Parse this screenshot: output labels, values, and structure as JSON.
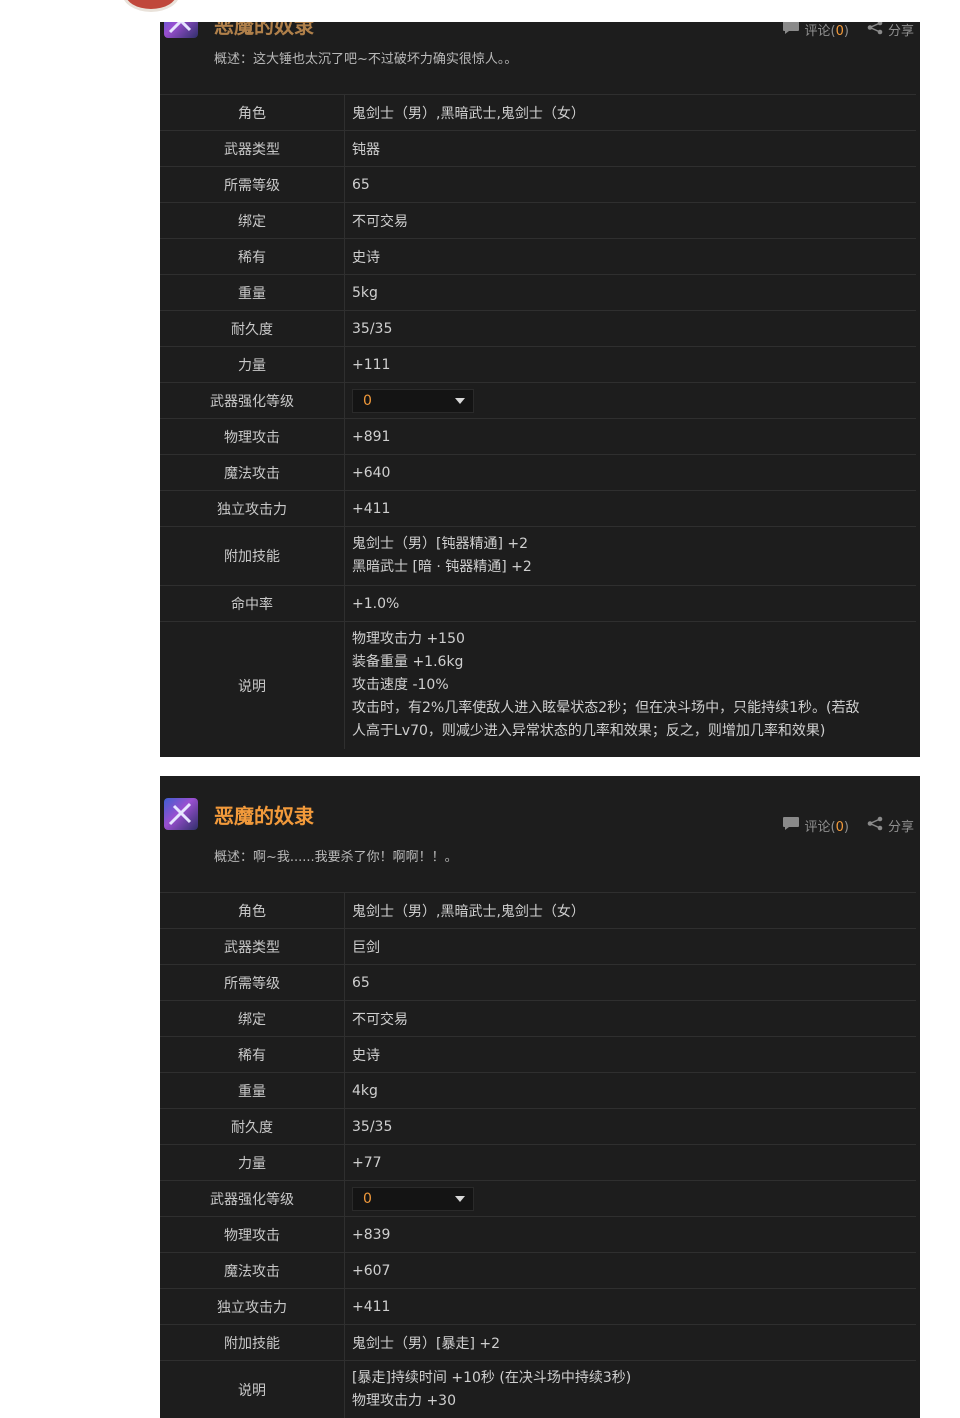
{
  "items": [
    {
      "title": "恶魔的奴隶",
      "comment_label": "评论(",
      "comment_count": "0",
      "comment_close": ")",
      "share_label": "分享",
      "summary": "概述：这大锤也太沉了吧~不过破坏力确实很惊人。。",
      "rows": {
        "role": {
          "key": "角色",
          "value": "鬼剑士（男）,黑暗武士,鬼剑士（女）"
        },
        "weapon_type": {
          "key": "武器类型",
          "value": "钝器"
        },
        "level": {
          "key": "所需等级",
          "value": "65"
        },
        "bind": {
          "key": "绑定",
          "value": "不可交易"
        },
        "rarity": {
          "key": "稀有",
          "value": "史诗"
        },
        "weight": {
          "key": "重量",
          "value": "5kg"
        },
        "durability": {
          "key": "耐久度",
          "value": "35/35"
        },
        "strength": {
          "key": "力量",
          "value": "+111"
        },
        "enhance": {
          "key": "武器强化等级",
          "value": "0"
        },
        "phys_atk": {
          "key": "物理攻击",
          "value": "+891"
        },
        "mag_atk": {
          "key": "魔法攻击",
          "value": "+640"
        },
        "ind_atk": {
          "key": "独立攻击力",
          "value": "+411"
        },
        "skills": {
          "key": "附加技能",
          "lines": [
            "鬼剑士（男）[钝器精通] +2",
            "黑暗武士 [暗 · 钝器精通] +2"
          ]
        },
        "hit": {
          "key": "命中率",
          "value": "+1.0%"
        },
        "desc": {
          "key": "说明",
          "lines": [
            "物理攻击力 +150",
            "装备重量 +1.6kg",
            "攻击速度 -10%",
            "攻击时，有2%几率使敌人进入眩晕状态2秒；但在决斗场中，只能持续1秒。(若敌",
            "人高于Lv70，则减少进入异常状态的几率和效果；反之，则增加几率和效果)"
          ]
        }
      }
    },
    {
      "title": "恶魔的奴隶",
      "comment_label": "评论(",
      "comment_count": "0",
      "comment_close": ")",
      "share_label": "分享",
      "summary": "概述：啊~我......我要杀了你！啊啊！！。",
      "rows": {
        "role": {
          "key": "角色",
          "value": "鬼剑士（男）,黑暗武士,鬼剑士（女）"
        },
        "weapon_type": {
          "key": "武器类型",
          "value": "巨剑"
        },
        "level": {
          "key": "所需等级",
          "value": "65"
        },
        "bind": {
          "key": "绑定",
          "value": "不可交易"
        },
        "rarity": {
          "key": "稀有",
          "value": "史诗"
        },
        "weight": {
          "key": "重量",
          "value": "4kg"
        },
        "durability": {
          "key": "耐久度",
          "value": "35/35"
        },
        "strength": {
          "key": "力量",
          "value": "+77"
        },
        "enhance": {
          "key": "武器强化等级",
          "value": "0"
        },
        "phys_atk": {
          "key": "物理攻击",
          "value": "+839"
        },
        "mag_atk": {
          "key": "魔法攻击",
          "value": "+607"
        },
        "ind_atk": {
          "key": "独立攻击力",
          "value": "+411"
        },
        "skills": {
          "key": "附加技能",
          "lines": [
            "鬼剑士（男）[暴走] +2"
          ]
        },
        "desc": {
          "key": "说明",
          "lines": [
            "[暴走]持续时间 +10秒 (在决斗场中持续3秒)",
            "物理攻击力 +30"
          ]
        }
      }
    }
  ],
  "colors": {
    "accent": "#f29a3b",
    "link": "#36c6d4",
    "card_bg": "#1d1d1d"
  },
  "icons": {
    "comment": "speech-bubble-icon",
    "share": "share-icon",
    "dropdown": "chevron-down-icon"
  }
}
